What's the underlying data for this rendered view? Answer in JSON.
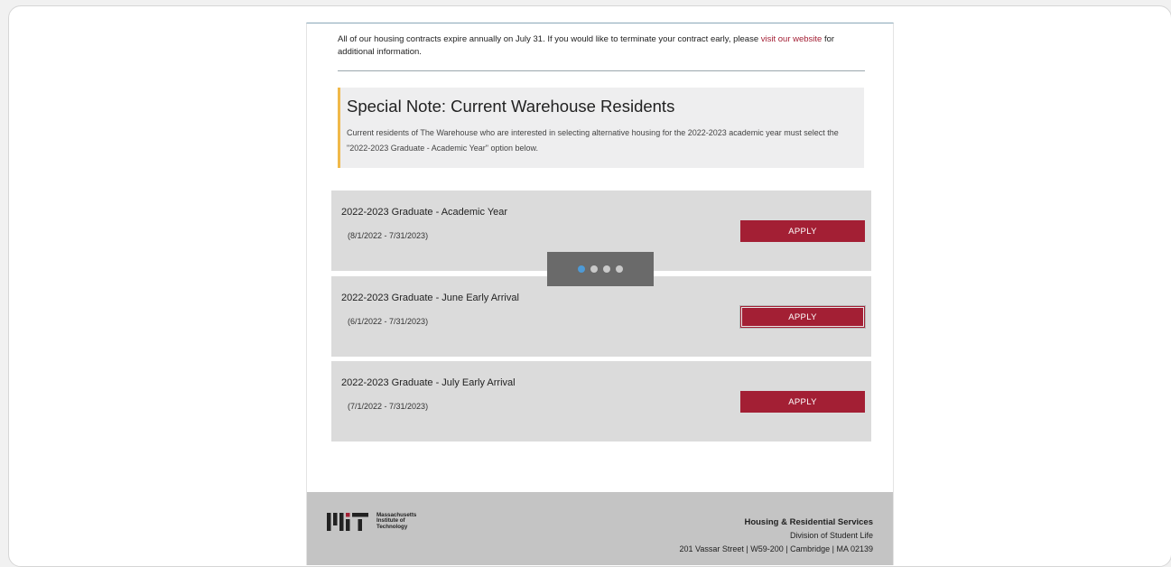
{
  "intro": {
    "text_before": "All of our housing contracts expire annually on July 31. If you would like to terminate your contract early, please ",
    "link_text": "visit our website",
    "text_after": " for additional information."
  },
  "special_note": {
    "title": "Special Note: Current Warehouse Residents",
    "body": "Current residents of The Warehouse who are interested in selecting alternative housing for the 2022-2023 academic year must select the \"2022-2023 Graduate - Academic Year\" option below."
  },
  "options": [
    {
      "title": "2022-2023 Graduate - Academic Year",
      "dates": "(8/1/2022 - 7/31/2023)",
      "button": "APPLY"
    },
    {
      "title": "2022-2023 Graduate - June Early Arrival",
      "dates": "(6/1/2022 - 7/31/2023)",
      "button": "APPLY"
    },
    {
      "title": "2022-2023 Graduate - July Early Arrival",
      "dates": "(7/1/2022 - 7/31/2023)",
      "button": "APPLY"
    }
  ],
  "footer": {
    "logo_lines": [
      "Massachusetts",
      "Institute of",
      "Technology"
    ],
    "department": "Housing & Residential Services",
    "division": "Division of Student Life",
    "address": "201 Vassar Street | W59-200 | Cambridge | MA 02139"
  },
  "colors": {
    "accent": "#a31f34",
    "note_border": "#f0b94a",
    "card_bg": "#dbdbdb",
    "footer_bg": "#c4c4c4",
    "loader_active": "#4e9ad6"
  }
}
